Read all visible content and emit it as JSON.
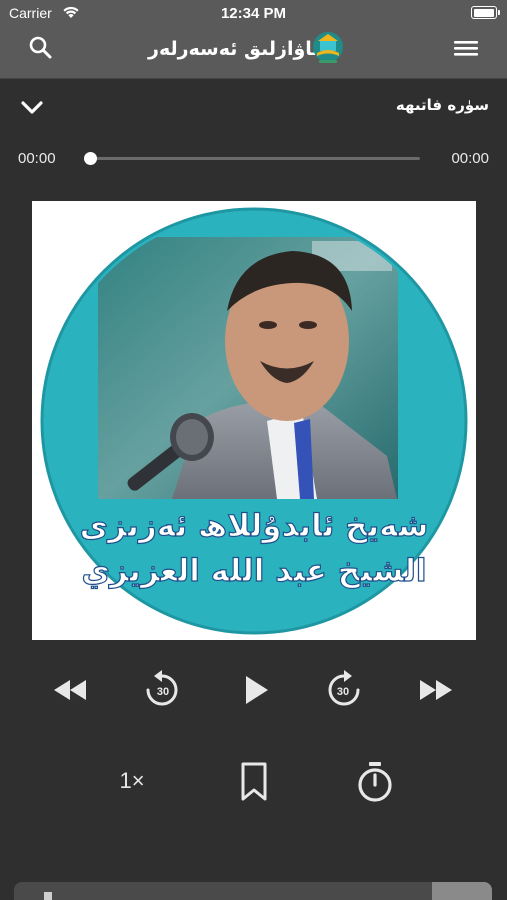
{
  "status_bar": {
    "carrier": "Carrier",
    "time": "12:34 PM",
    "battery_level": 1.0,
    "icons": [
      "wifi-icon",
      "battery-icon"
    ]
  },
  "nav": {
    "title": "ئاۋازلىق ئەسەرلەر",
    "icons": [
      "search-icon",
      "app-logo-icon",
      "hamburger-menu-icon"
    ]
  },
  "player": {
    "track_title": "سۈرە فاتىھە",
    "current_time": "00:00",
    "total_time": "00:00",
    "progress": 0.0,
    "artwork": {
      "caption_line1": "شەيخ ئابدۇللاھ ئەزىزى",
      "caption_line2": "الشيخ عبد الله العزيزي",
      "accent_color": "#2ab3be"
    },
    "controls": {
      "speed_label": "1×",
      "skip_back_seconds": "30",
      "skip_forward_seconds": "30",
      "icons": [
        "rewind-icon",
        "skip-back-30-icon",
        "play-icon",
        "skip-forward-30-icon",
        "fast-forward-icon",
        "bookmark-icon",
        "timer-icon",
        "chevron-down-icon"
      ]
    }
  },
  "colors": {
    "background": "#2f2f2f",
    "navbar": "#5a5a5a",
    "foreground": "#ffffff"
  }
}
